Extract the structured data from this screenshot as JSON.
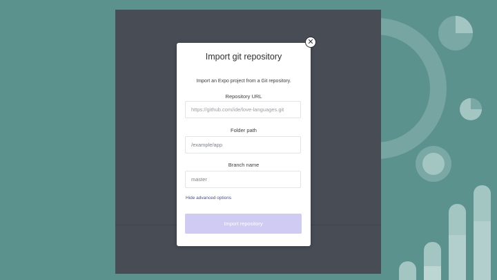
{
  "colors": {
    "background": "#5c928e",
    "panel": "#484c54",
    "modal": "#ffffff",
    "button_disabled": "#cfcbf2",
    "link": "#4a4d8c"
  },
  "icons": {
    "close": "close-icon"
  },
  "modal": {
    "title": "Import git repository",
    "description": "Import an Expo project from a Git repository.",
    "close_label": "✕",
    "repository_url": {
      "label": "Repository URL",
      "placeholder": "https://github.com/ide/love-languages.git"
    },
    "folder_path": {
      "label": "Folder path",
      "value": "/example/app"
    },
    "branch_name": {
      "label": "Branch name",
      "value": "master"
    },
    "advanced_link": "Hide advanced options",
    "submit_label": "Import repository"
  }
}
